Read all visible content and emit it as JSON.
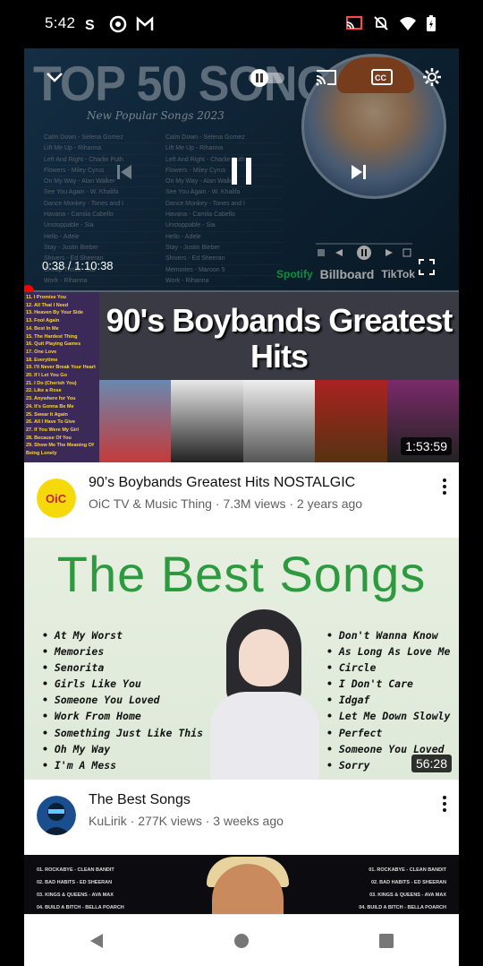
{
  "status_bar": {
    "time": "5:42",
    "left_icons": [
      "s-sync-icon",
      "chrome-icon",
      "gmail-icon"
    ],
    "right_icons": [
      "cast-icon",
      "mute-icon",
      "wifi-icon",
      "battery-icon"
    ]
  },
  "player": {
    "thumbnail": {
      "title": "TOP 50 SONGS",
      "subtitle": "New Popular Songs 2023",
      "tracks_left": [
        "Calm Down - Selena Gomez",
        "Lift Me Up - Rihanna",
        "Left And Right - Charlie Puth",
        "Flowers - Miley Cyrus",
        "On My Way - Alan Walker",
        "See You Again - W. Khalifa",
        "Dance Monkey - Tones and I",
        "Havana - Camila Cabello",
        "Unstoppable - Sia",
        "Hello - Adele",
        "Stay - Justin Bieber",
        "Shivers - Ed Sheeran",
        "Cheap Thrills - Sia",
        "Work - Rihanna"
      ],
      "tracks_right": [
        "Calm Down - Selena Gomez",
        "Lift Me Up - Rihanna",
        "Left And Right - Charlie Puth",
        "Flowers - Miley Cyrus",
        "On My Way - Alan Walker",
        "See You Again - W. Khalifa",
        "Dance Monkey - Tones and I",
        "Havana - Camila Cabello",
        "Unstoppable - Sia",
        "Hello - Adele",
        "Stay - Justin Bieber",
        "Shivers - Ed Sheeran",
        "Memories - Maroon 5",
        "Work - Rihanna"
      ],
      "logos": [
        "Spotify",
        "Billboard",
        "TikTok"
      ]
    },
    "current_time": "0:38",
    "separator": " / ",
    "total_time": "1:10:38",
    "progress_fraction": 0.009
  },
  "videos": [
    {
      "title": "90’s Boybands Greatest Hits NOSTALGIC",
      "channel": "OiC TV & Music Thing",
      "views": "7.3M views",
      "age": "2 years ago",
      "duration": "1:53:59",
      "thumb_title": "90's Boybands Greatest Hits",
      "thumb_list": [
        "11.    I Promise You",
        "12.    All That I Need",
        "13.    Heaven By Your Side",
        "13.    Fool Again",
        "14.    Best In Me",
        "15.    The Hardest Thing",
        "16.    Quit Playing Games",
        "17.    One Love",
        "18.    Everytime",
        "19.    I'll Never Break Your Heart",
        "20.    If I Let You Go",
        "21.    I Do (Cherish You)",
        "22.    Like a Rose",
        "23.    Anywhere for You",
        "24.    It's Gonna Be Me",
        "25.    Swear It Again",
        "26.    All I Have To Give",
        "27.    If You Were My Girl",
        "28.    Because Of You",
        "29.    Show Me The Meaning Of",
        "       Being Lonely"
      ]
    },
    {
      "title": "The Best Songs",
      "channel": "KuLirik",
      "views": "277K views",
      "age": "3 weeks ago",
      "duration": "56:28",
      "thumb_title": "The Best Songs",
      "list_left": [
        "At My Worst",
        "Memories",
        "Senorita",
        "Girls Like You",
        "Someone You Loved",
        "Work From Home",
        "Something Just Like This",
        "Oh My Way",
        "I'm A Mess"
      ],
      "list_right": [
        "Don't Wanna Know",
        "As Long As Love Me",
        "Circle",
        "I Don't Care",
        "Idgaf",
        "Let Me Down Slowly",
        "Perfect",
        "Someone You Loved",
        "Sorry"
      ]
    },
    {
      "list_left": [
        "01. ROCKABYE - CLEAN BANDIT",
        "02. BAD HABITS - ED SHEERAN",
        "03. KINGS & QUEENS - AVA MAX",
        "04. BUILD A BITCH - BELLA POARCH"
      ],
      "list_right": [
        "01. ROCKABYE - CLEAN BANDIT",
        "02. BAD HABITS - ED SHEERAN",
        "03. KINGS & QUEENS - AVA MAX",
        "04. BUILD A BITCH - BELLA POARCH"
      ]
    }
  ],
  "colors": {
    "accent": "#ff0000",
    "brand_green": "#2e9a3f"
  }
}
